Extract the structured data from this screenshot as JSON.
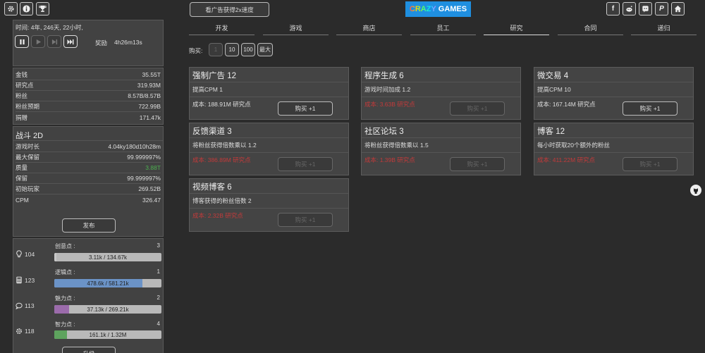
{
  "top_left_icons": [
    "gear-icon",
    "info-icon",
    "trophy-icon"
  ],
  "ad_button": "看广告获得2x速度",
  "logo": {
    "crazy": "CRAZY",
    "games": "GAMES"
  },
  "social_icons": [
    "facebook-icon",
    "reddit-icon",
    "discord-icon",
    "paypal-icon",
    "home-icon"
  ],
  "time_panel": {
    "time": "时间:  4年,  246天,  22小时,",
    "reward_label": "奖励",
    "reward_value": "4h26m13s"
  },
  "stats": [
    {
      "label": "金钱",
      "value": "35.55T"
    },
    {
      "label": "研究点",
      "value": "319.93M"
    },
    {
      "label": "粉丝",
      "value": "8.57B/8.57B"
    },
    {
      "label": "粉丝预期",
      "value": "722.99B"
    },
    {
      "label": "捐赠",
      "value": "171.47k"
    }
  ],
  "game": {
    "title": "战斗 2D",
    "rows": [
      {
        "label": "游戏时长",
        "value": "4.04ky180d10h28m"
      },
      {
        "label": "最大保留",
        "value": "99.999997%"
      },
      {
        "label": "质量",
        "value": "3.88T"
      },
      {
        "label": "保留",
        "value": "99.999997%"
      },
      {
        "label": "初始玩家",
        "value": "269.52B"
      },
      {
        "label": "CPM",
        "value": "326.47"
      }
    ],
    "publish": "发布"
  },
  "skills": [
    {
      "icon": "lightbulb-icon",
      "count": "104",
      "label": "创意点 :",
      "level": "3",
      "bar": "3.11k / 134.67k",
      "progress": 0.023,
      "color": "#c8c8c8"
    },
    {
      "icon": "calculator-icon",
      "count": "123",
      "label": "逻辑点 :",
      "level": "1",
      "bar": "478.6k / 581.21k",
      "progress": 0.82,
      "color": "#6b93c7"
    },
    {
      "icon": "chat-icon",
      "count": "113",
      "label": "魅力点 :",
      "level": "2",
      "bar": "37.13k / 269.21k",
      "progress": 0.14,
      "color": "#9b6bab"
    },
    {
      "icon": "cog-icon",
      "count": "118",
      "label": "智力点 :",
      "level": "4",
      "bar": "161.1k / 1.32M",
      "progress": 0.12,
      "color": "#5ea35e"
    }
  ],
  "upgrade": "升级",
  "tabs": [
    "开发",
    "游戏",
    "商店",
    "员工",
    "研究",
    "合同",
    "递归"
  ],
  "buy": {
    "label": "购买:",
    "options": [
      "1",
      "10",
      "100",
      "最大"
    ]
  },
  "cards": [
    {
      "title": "强制广告 12",
      "desc": "提高CPM 1",
      "cost": "成本: 188.91M 研究点",
      "affordable": true,
      "buy": "购买 +1"
    },
    {
      "title": "程序生成 6",
      "desc": "游戏时间加成 1.2",
      "cost": "成本: 3.63B 研究点",
      "affordable": false,
      "buy": "购买 +1"
    },
    {
      "title": "微交易 4",
      "desc": "提高CPM 10",
      "cost": "成本: 167.14M 研究点",
      "affordable": true,
      "buy": "购买 +1"
    },
    {
      "title": "反馈渠道 3",
      "desc": "将粉丝获得倍数乘以 1.2",
      "cost": "成本: 386.89M 研究点",
      "affordable": false,
      "buy": "购买 +1"
    },
    {
      "title": "社区论坛 3",
      "desc": "将粉丝获得倍数乘以 1.5",
      "cost": "成本: 1.39B 研究点",
      "affordable": false,
      "buy": "购买 +1"
    },
    {
      "title": "博客 12",
      "desc": "每小时获取20个额外的粉丝",
      "cost": "成本: 411.22M 研究点",
      "affordable": false,
      "buy": "购买 +1"
    },
    {
      "title": "视频博客 6",
      "desc": "博客获得的粉丝倍数 2",
      "cost": "成本: 2.32B 研究点",
      "affordable": false,
      "buy": "购买 +1"
    }
  ]
}
